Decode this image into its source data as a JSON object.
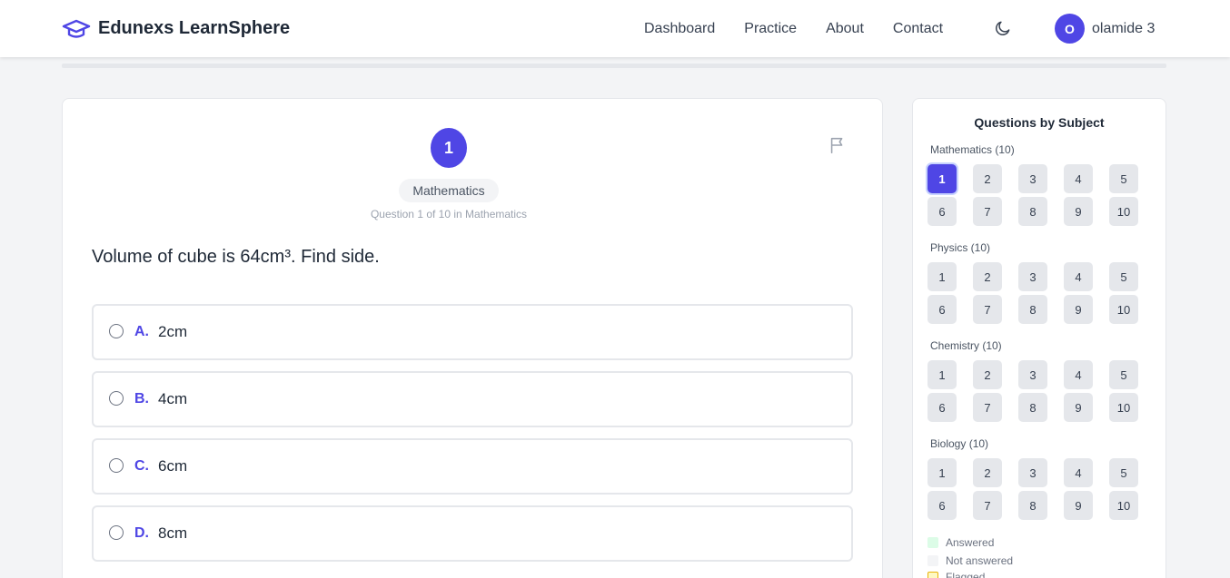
{
  "nav": {
    "brand": "Edunexs LearnSphere",
    "links": [
      "Dashboard",
      "Practice",
      "About",
      "Contact"
    ],
    "user_initial": "O",
    "user_name": "olamide 3"
  },
  "question": {
    "number": "1",
    "subject": "Mathematics",
    "progress_text": "Question 1 of 10 in Mathematics",
    "text": "Volume of cube is 64cm³. Find side.",
    "options": [
      {
        "letter": "A.",
        "text": "2cm"
      },
      {
        "letter": "B.",
        "text": "4cm"
      },
      {
        "letter": "C.",
        "text": "6cm"
      },
      {
        "letter": "D.",
        "text": "8cm"
      }
    ]
  },
  "sidebar": {
    "title": "Questions by Subject",
    "subjects": [
      {
        "label": "Mathematics (10)",
        "numbers": [
          "1",
          "2",
          "3",
          "4",
          "5",
          "6",
          "7",
          "8",
          "9",
          "10"
        ],
        "current": 0
      },
      {
        "label": "Physics (10)",
        "numbers": [
          "1",
          "2",
          "3",
          "4",
          "5",
          "6",
          "7",
          "8",
          "9",
          "10"
        ],
        "current": -1
      },
      {
        "label": "Chemistry (10)",
        "numbers": [
          "1",
          "2",
          "3",
          "4",
          "5",
          "6",
          "7",
          "8",
          "9",
          "10"
        ],
        "current": -1
      },
      {
        "label": "Biology (10)",
        "numbers": [
          "1",
          "2",
          "3",
          "4",
          "5",
          "6",
          "7",
          "8",
          "9",
          "10"
        ],
        "current": -1
      }
    ],
    "legend": [
      {
        "label": "Answered",
        "color": "#dcfce7"
      },
      {
        "label": "Not answered",
        "color": "#f3f4f6"
      },
      {
        "label": "Flagged",
        "color": "#fef9c3"
      }
    ]
  },
  "colors": {
    "accent": "#4f46e5"
  },
  "progress": {
    "fraction": 0
  }
}
